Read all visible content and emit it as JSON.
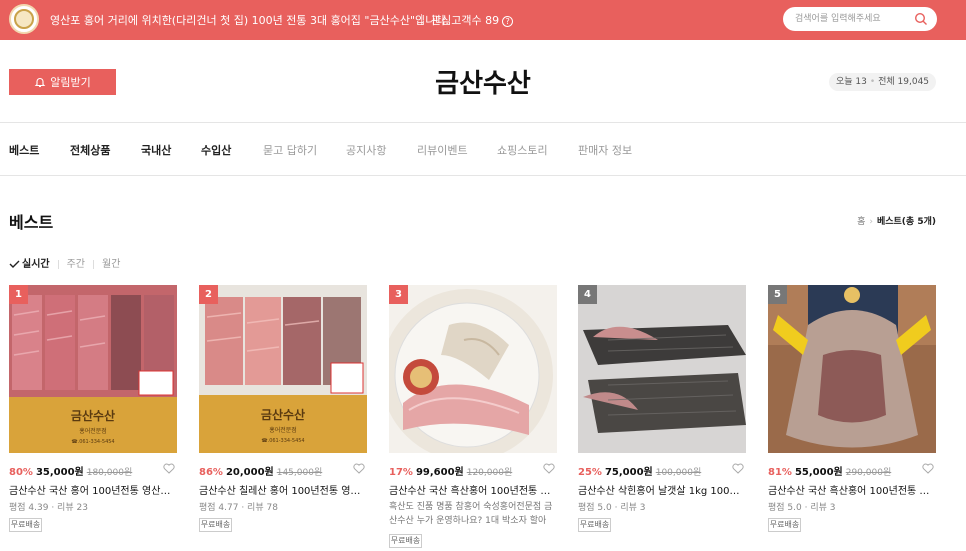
{
  "topbar": {
    "notice": "영산포 홍어 거리에 위치한(다리건너 첫 집) 100년 전통 3대 홍어집 \"금산수산\"입니다.",
    "interest_label": "관심고객수 89",
    "help_symbol": "?",
    "search_placeholder": "검색어를 입력해주세요"
  },
  "header": {
    "alarm_label": "알림받기",
    "store_name": "금산수산",
    "today": "오늘 13",
    "total": "전체 19,045"
  },
  "nav": [
    {
      "label": "베스트"
    },
    {
      "label": "전체상품"
    },
    {
      "label": "국내산"
    },
    {
      "label": "수입산"
    },
    {
      "label": "묻고 답하기"
    },
    {
      "label": "공지사항"
    },
    {
      "label": "리뷰이벤트"
    },
    {
      "label": "쇼핑스토리"
    },
    {
      "label": "판매자 정보"
    }
  ],
  "section": {
    "title": "베스트",
    "crumb_home": "홈",
    "crumb_current": "베스트(총 5개)"
  },
  "period": {
    "realtime": "실시간",
    "weekly": "주간",
    "monthly": "월간"
  },
  "products": [
    {
      "rank": "1",
      "discount": "80%",
      "price": "35,000원",
      "original": "180,000원",
      "name": "금산수산 국산 홍어 100년전통 영산포 3...",
      "rating": "평점 4.39 · 리뷰 23",
      "badge": "무료배송"
    },
    {
      "rank": "2",
      "discount": "86%",
      "price": "20,000원",
      "original": "145,000원",
      "name": "금산수산 칠레산 홍어 100년전통 영산...",
      "rating": "평점 4.77 · 리뷰 78",
      "badge": "무료배송"
    },
    {
      "rank": "3",
      "discount": "17%",
      "price": "99,600원",
      "original": "120,000원",
      "name": "금산수산 국산 흑산홍어 100년전통 영...",
      "desc": "흑산도 진품 명품 참홍어 숙성홍어전문점 금산수산 누가 운영하나요? 1대 박소자 할아버...",
      "badge": "무료배송"
    },
    {
      "rank": "4",
      "discount": "25%",
      "price": "75,000원",
      "original": "100,000원",
      "name": "금산수산 삭힌홍어 날갯살 1kg 100년전...",
      "rating": "평점 5.0 · 리뷰 3",
      "badge": "무료배송"
    },
    {
      "rank": "5",
      "discount": "81%",
      "price": "55,000원",
      "original": "290,000원",
      "name": "금산수산 국산 흑산홍어 100년전통 영...",
      "rating": "평점 5.0 · 리뷰 3",
      "badge": "무료배송"
    }
  ],
  "colors": {
    "accent": "#e8605d"
  }
}
